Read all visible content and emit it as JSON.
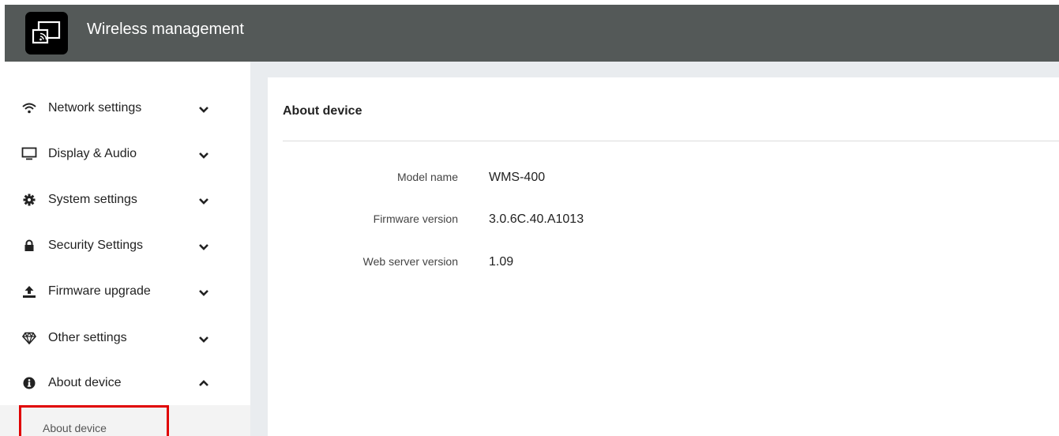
{
  "header": {
    "title": "Wireless management",
    "logo_icon": "screen-cast-icon",
    "background": "#545958"
  },
  "sidebar": {
    "items": [
      {
        "label": "Network settings",
        "icon": "wifi-icon",
        "expanded": false
      },
      {
        "label": "Display & Audio",
        "icon": "monitor-icon",
        "expanded": false
      },
      {
        "label": "System settings",
        "icon": "gear-icon",
        "expanded": false
      },
      {
        "label": "Security Settings",
        "icon": "lock-icon",
        "expanded": false
      },
      {
        "label": "Firmware upgrade",
        "icon": "upload-icon",
        "expanded": false
      },
      {
        "label": "Other settings",
        "icon": "diamond-icon",
        "expanded": false
      },
      {
        "label": "About device",
        "icon": "info-icon",
        "expanded": true
      }
    ],
    "subitem": {
      "label": "About device",
      "highlight_color": "#e00000"
    }
  },
  "main": {
    "title": "About device",
    "rows": [
      {
        "label": "Model name",
        "value": "WMS-400"
      },
      {
        "label": "Firmware version",
        "value": "3.0.6C.40.A1013"
      },
      {
        "label": "Web server version",
        "value": "1.09"
      }
    ]
  }
}
